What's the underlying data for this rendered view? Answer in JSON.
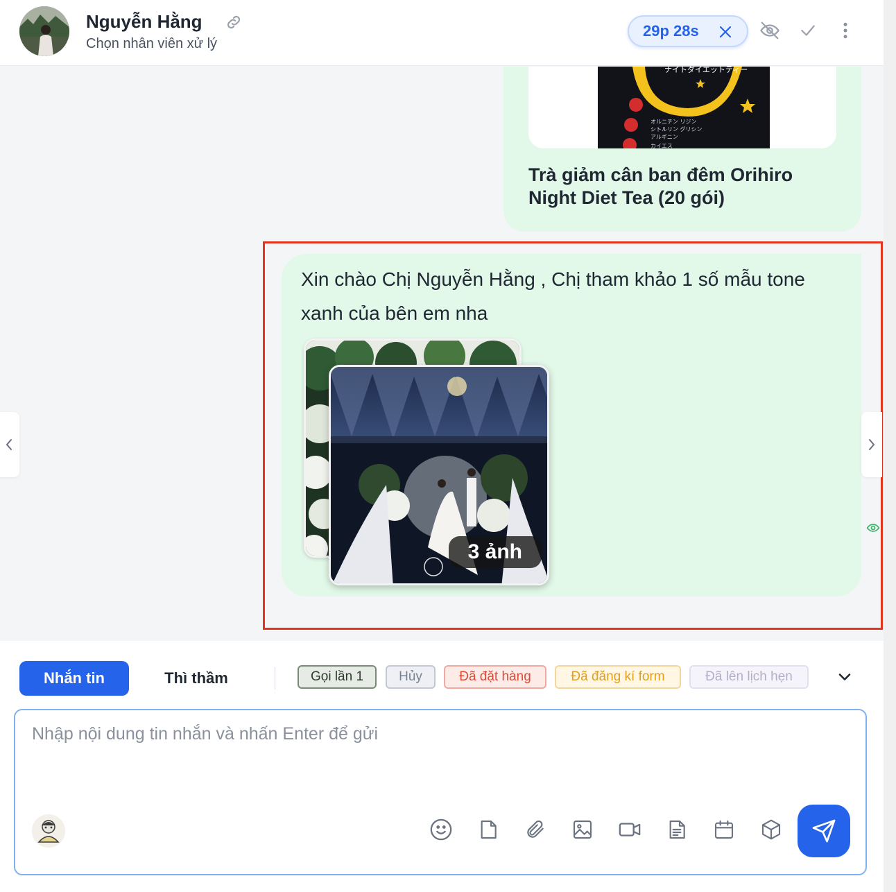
{
  "header": {
    "contact_name": "Nguyễn Hằng",
    "assign_placeholder": "Chọn nhân viên xử lý",
    "timer": "29p 28s",
    "icons": [
      "link-icon",
      "close-icon",
      "eye-off-icon",
      "check-icon",
      "more-vertical-icon"
    ]
  },
  "chat": {
    "previous_product": {
      "title": "Trà giảm cân ban đêm Orihiro Night Diet Tea (20 gói)",
      "image_text": [
        "ナイトダイエットティー",
        "オルニチン リジン",
        "シトルリン グリシン",
        "アルギニン",
        "カイエス"
      ]
    },
    "message": {
      "text": "Xin chào Chị Nguyễn Hằng , Chị tham khảo 1 số mẫu tone xanh của bên em nha",
      "image_count_label": "3 ảnh",
      "status_icon": "eye-icon"
    },
    "colors": {
      "bubble": "#e2f8e8",
      "highlight": "#e1351f"
    }
  },
  "composer": {
    "tabs": [
      {
        "label": "Nhắn tin",
        "active": true
      },
      {
        "label": "Thì thầm",
        "active": false
      }
    ],
    "tags": [
      {
        "label": "Gọi lần 1",
        "color": "#7b8a78"
      },
      {
        "label": "Hủy",
        "color": "#c4c8d2"
      },
      {
        "label": "Đã đặt hàng",
        "color": "#e04a35"
      },
      {
        "label": "Đã đăng kí form",
        "color": "#e0a021"
      },
      {
        "label": "Đã lên lịch hẹn",
        "color": "#b4adc9"
      }
    ],
    "input_placeholder": "Nhập nội dung tin nhắn và nhấn Enter để gửi",
    "input_value": "",
    "toolbar_icons": [
      "emoji-icon",
      "file-icon",
      "attachment-icon",
      "image-icon",
      "video-icon",
      "document-icon",
      "calendar-icon",
      "product-box-icon",
      "send-icon"
    ],
    "accent_color": "#2563eb"
  }
}
